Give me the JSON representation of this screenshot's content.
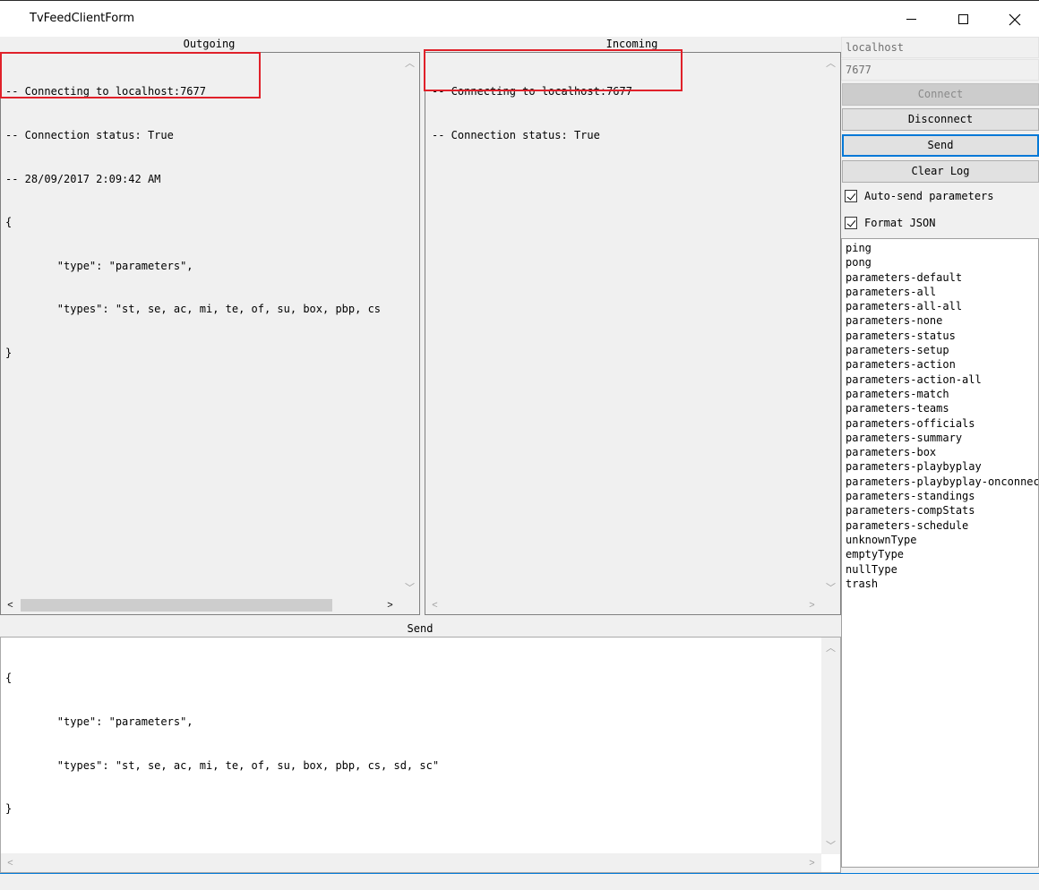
{
  "window": {
    "title": "TvFeedClientForm"
  },
  "labels": {
    "outgoing": "Outgoing",
    "incoming": "Incoming",
    "send": "Send"
  },
  "outgoing_log": {
    "lines": [
      "-- Connecting to localhost:7677",
      "-- Connection status: True",
      "-- 28/09/2017 2:09:42 AM",
      "{",
      "        \"type\": \"parameters\",",
      "        \"types\": \"st, se, ac, mi, te, of, su, box, pbp, cs",
      "}"
    ]
  },
  "incoming_log": {
    "lines": [
      "-- Connecting to localhost:7677",
      "-- Connection status: True"
    ]
  },
  "send_text": {
    "lines": [
      "{",
      "        \"type\": \"parameters\",",
      "        \"types\": \"st, se, ac, mi, te, of, su, box, pbp, cs, sd, sc\"",
      "}"
    ]
  },
  "connection": {
    "host": "localhost",
    "port": "7677"
  },
  "buttons": {
    "connect": "Connect",
    "disconnect": "Disconnect",
    "send": "Send",
    "clear_log": "Clear Log"
  },
  "options": {
    "auto_send": "Auto-send parameters",
    "format_json": "Format JSON"
  },
  "message_types": [
    "ping",
    "pong",
    "parameters-default",
    "parameters-all",
    "parameters-all-all",
    "parameters-none",
    "parameters-status",
    "parameters-setup",
    "parameters-action",
    "parameters-action-all",
    "parameters-match",
    "parameters-teams",
    "parameters-officials",
    "parameters-summary",
    "parameters-box",
    "parameters-playbyplay",
    "parameters-playbyplay-onconnect",
    "parameters-standings",
    "parameters-compStats",
    "parameters-schedule",
    "unknownType",
    "emptyType",
    "nullType",
    "trash"
  ],
  "colors": {
    "highlight": "#e0212a",
    "focus": "#0078d7"
  }
}
